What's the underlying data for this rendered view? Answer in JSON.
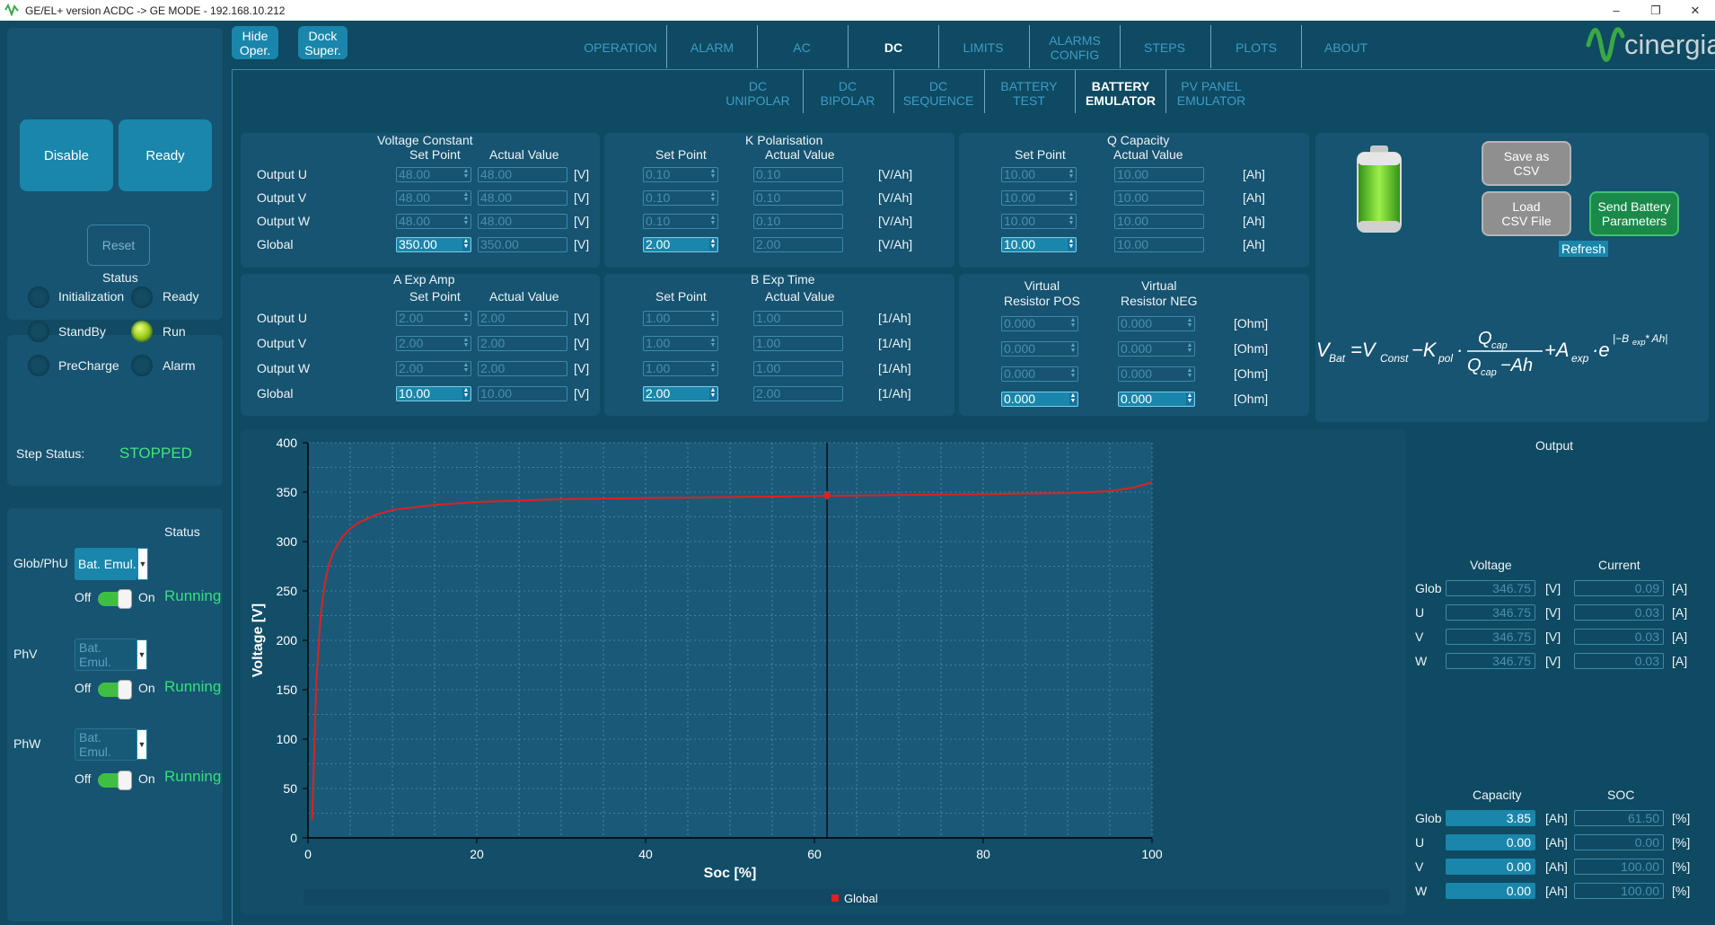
{
  "window": {
    "title": "GE/EL+ version ACDC -> GE MODE - 192.168.10.212"
  },
  "dock": {
    "hide": "Hide\nOper.",
    "dock": "Dock\nSuper."
  },
  "tabs": [
    {
      "label": "OPERATION"
    },
    {
      "label": "ALARM"
    },
    {
      "label": "AC"
    },
    {
      "label": "DC"
    },
    {
      "label": "LIMITS"
    },
    {
      "label": "ALARMS\nCONFIG"
    },
    {
      "label": "STEPS"
    },
    {
      "label": "PLOTS"
    },
    {
      "label": "ABOUT"
    }
  ],
  "subtabs": [
    {
      "label": "DC\nUNIPOLAR"
    },
    {
      "label": "DC\nBIPOLAR"
    },
    {
      "label": "DC\nSEQUENCE"
    },
    {
      "label": "BATTERY\nTEST"
    },
    {
      "label": "BATTERY\nEMULATOR"
    },
    {
      "label": "PV PANEL\nEMULATOR"
    }
  ],
  "brand": "cinergia",
  "left": {
    "disable": "Disable",
    "ready": "Ready",
    "reset": "Reset",
    "status_title": "Status",
    "states": [
      "Initialization",
      "Ready",
      "StandBy",
      "Run",
      "PreCharge",
      "Alarm"
    ],
    "step_status_label": "Step Status:",
    "step_status_value": "STOPPED",
    "phase_status_title": "Status",
    "phases": [
      {
        "label": "Glob/PhU",
        "mode": "Bat. Emul.",
        "off": "Off",
        "on": "On",
        "state": "Running"
      },
      {
        "label": "PhV",
        "mode": "Bat. Emul.",
        "off": "Off",
        "on": "On",
        "state": "Running"
      },
      {
        "label": "PhW",
        "mode": "Bat. Emul.",
        "off": "Off",
        "on": "On",
        "state": "Running"
      }
    ]
  },
  "rows": [
    "Output U",
    "Output V",
    "Output W",
    "Global"
  ],
  "vc": {
    "title": "Voltage Constant",
    "sp": "Set Point",
    "av": "Actual Value",
    "unit": "[V]",
    "set": [
      "48.00",
      "48.00",
      "48.00",
      "350.00"
    ],
    "act": [
      "48.00",
      "48.00",
      "48.00",
      "350.00"
    ]
  },
  "kp": {
    "title": "K Polarisation",
    "sp": "Set Point",
    "av": "Actual Value",
    "unit": "[V/Ah]",
    "set": [
      "0.10",
      "0.10",
      "0.10",
      "2.00"
    ],
    "act": [
      "0.10",
      "0.10",
      "0.10",
      "2.00"
    ]
  },
  "qc": {
    "title": "Q Capacity",
    "sp": "Set Point",
    "av": "Actual Value",
    "unit": "[Ah]",
    "set": [
      "10.00",
      "10.00",
      "10.00",
      "10.00"
    ],
    "act": [
      "10.00",
      "10.00",
      "10.00",
      "10.00"
    ]
  },
  "ae": {
    "title": "A Exp Amp",
    "sp": "Set Point",
    "av": "Actual Value",
    "unit": "[V]",
    "set": [
      "2.00",
      "2.00",
      "2.00",
      "10.00"
    ],
    "act": [
      "2.00",
      "2.00",
      "2.00",
      "10.00"
    ]
  },
  "be": {
    "title": "B Exp Time",
    "sp": "Set Point",
    "av": "Actual Value",
    "unit": "[1/Ah]",
    "set": [
      "1.00",
      "1.00",
      "1.00",
      "2.00"
    ],
    "act": [
      "1.00",
      "1.00",
      "1.00",
      "2.00"
    ]
  },
  "vr": {
    "pos_title": "Virtual\nResistor POS",
    "neg_title": "Virtual\nResistor NEG",
    "unit": "[Ohm]",
    "pos": [
      "0.000",
      "0.000",
      "0.000",
      "0.000"
    ],
    "neg": [
      "0.000",
      "0.000",
      "0.000",
      "0.000"
    ]
  },
  "actions": {
    "save": "Save as\nCSV",
    "load": "Load\nCSV File",
    "send": "Send Battery\nParameters",
    "refresh": "Refresh"
  },
  "output": {
    "title": "Output",
    "voltage": "Voltage",
    "current": "Current",
    "capacity": "Capacity",
    "soc": "SOC",
    "rows": [
      "Glob",
      "U",
      "V",
      "W"
    ],
    "v": [
      "346.75",
      "346.75",
      "346.75",
      "346.75"
    ],
    "i": [
      "0.09",
      "0.03",
      "0.03",
      "0.03"
    ],
    "cap": [
      "3.85",
      "0.00",
      "0.00",
      "0.00"
    ],
    "socv": [
      "61.50",
      "0.00",
      "100.00",
      "100.00"
    ],
    "vu": "[V]",
    "iu": "[A]",
    "cu": "[Ah]",
    "su": "[%]"
  },
  "chart_data": {
    "type": "line",
    "xlabel": "Soc [%]",
    "ylabel": "Voltage [V]",
    "xlim": [
      0,
      100
    ],
    "ylim": [
      0,
      400
    ],
    "xticks": [
      0,
      20,
      40,
      60,
      80,
      100
    ],
    "yticks": [
      0,
      50,
      100,
      150,
      200,
      250,
      300,
      350,
      400
    ],
    "grid": true,
    "legend": "bottom",
    "series": [
      {
        "name": "Global",
        "color": "#e02020",
        "x": [
          0.5,
          1,
          1.5,
          2,
          2.5,
          3,
          4,
          5,
          6,
          8,
          10,
          15,
          20,
          30,
          40,
          50,
          60,
          70,
          80,
          90,
          95,
          98,
          100
        ],
        "y": [
          18,
          160,
          225,
          258,
          277,
          289,
          304,
          313,
          319,
          327,
          332,
          337,
          340,
          343,
          344,
          345,
          346,
          347,
          348,
          349,
          351,
          355,
          360
        ]
      }
    ],
    "marker": {
      "x": 61.5,
      "y": 346.75
    }
  }
}
